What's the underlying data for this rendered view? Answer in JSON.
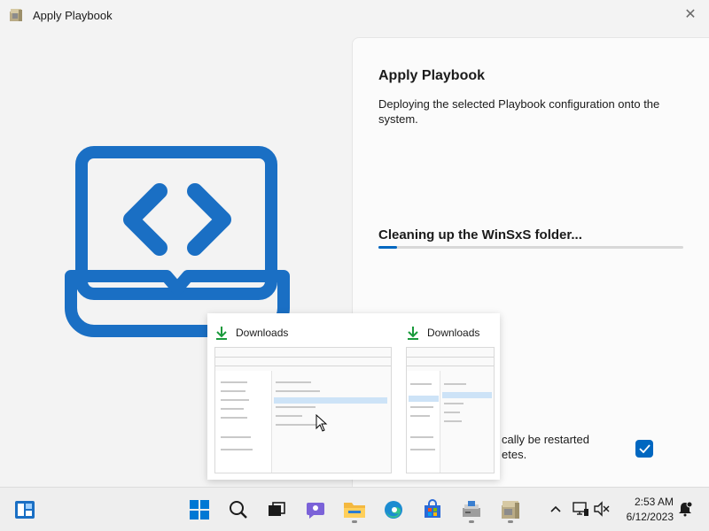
{
  "window": {
    "title": "Apply Playbook",
    "close_glyph": "✕"
  },
  "panel": {
    "title": "Apply Playbook",
    "description": "Deploying the selected Playbook configuration onto the system.",
    "status": "Cleaning up the WinSxS folder...",
    "progress": 0.06,
    "restart_text": "cally be restarted\netes.",
    "restart_checked": true
  },
  "thumbnails": [
    {
      "title": "Downloads",
      "icon": "download-icon"
    },
    {
      "title": "Downloads",
      "icon": "download-icon"
    }
  ],
  "taskbar": {
    "items": [
      "widgets-icon",
      "start-icon",
      "search-icon",
      "task-view-icon",
      "chat-icon",
      "file-explorer-icon",
      "edge-icon",
      "store-icon",
      "installer-icon",
      "playbook-app-icon"
    ],
    "tray": [
      "chevron-up-icon",
      "network-icon",
      "volume-muted-icon"
    ],
    "time": "2:53 AM",
    "date": "6/12/2023",
    "notification_icon": "notification-icon"
  },
  "colors": {
    "accent": "#0067c0",
    "hero": "#1a6fc4"
  }
}
